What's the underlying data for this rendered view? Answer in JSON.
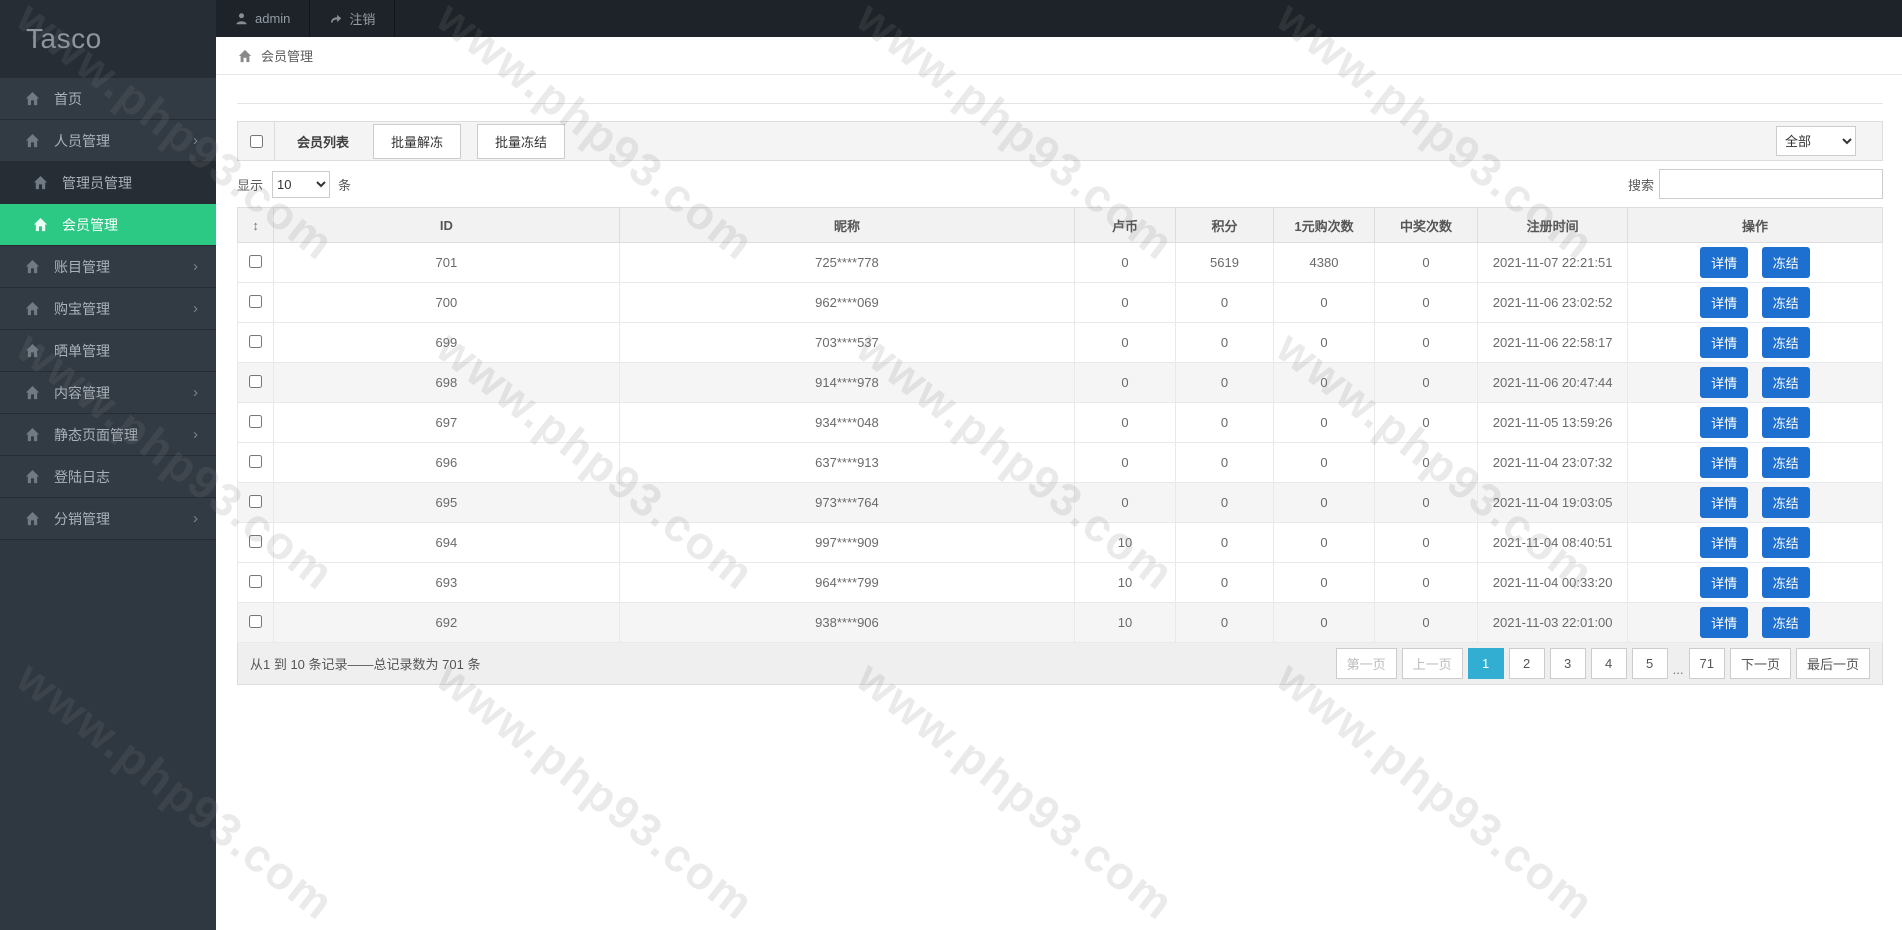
{
  "colors": {
    "accent_green": "#2cc985",
    "button_blue": "#1e70d0",
    "page_active": "#31aed1"
  },
  "watermark": {
    "text": "www.php93.com"
  },
  "topbar": {
    "user": "admin",
    "logout": "注销"
  },
  "sidebar": {
    "logo": "Tasco",
    "items": [
      {
        "label": "首页",
        "type": "item"
      },
      {
        "label": "人员管理",
        "type": "parent"
      },
      {
        "label": "管理员管理",
        "type": "sub"
      },
      {
        "label": "会员管理",
        "type": "sub",
        "active": true
      },
      {
        "label": "账目管理",
        "type": "parent"
      },
      {
        "label": "购宝管理",
        "type": "parent"
      },
      {
        "label": "晒单管理",
        "type": "item"
      },
      {
        "label": "内容管理",
        "type": "parent"
      },
      {
        "label": "静态页面管理",
        "type": "parent"
      },
      {
        "label": "登陆日志",
        "type": "item"
      },
      {
        "label": "分销管理",
        "type": "parent"
      }
    ]
  },
  "breadcrumb": {
    "label": "会员管理"
  },
  "toolbar": {
    "list_label": "会员列表",
    "batch_unfreeze": "批量解冻",
    "batch_freeze": "批量冻结",
    "filter_selected": "全部",
    "show_label": "显示",
    "page_size": "10",
    "unit_label": "条",
    "search_label": "搜索",
    "search_value": ""
  },
  "table": {
    "sort_icon": "↕",
    "columns": [
      "ID",
      "昵称",
      "卢币",
      "积分",
      "1元购次数",
      "中奖次数",
      "注册时间",
      "操作"
    ],
    "detail_btn": "详情",
    "freeze_btn": "冻结",
    "rows": [
      {
        "id": "701",
        "nick": "725****778",
        "coin": "0",
        "points": "5619",
        "buy": "4380",
        "win": "0",
        "time": "2021-11-07 22:21:51"
      },
      {
        "id": "700",
        "nick": "962****069",
        "coin": "0",
        "points": "0",
        "buy": "0",
        "win": "0",
        "time": "2021-11-06 23:02:52"
      },
      {
        "id": "699",
        "nick": "703****537",
        "coin": "0",
        "points": "0",
        "buy": "0",
        "win": "0",
        "time": "2021-11-06 22:58:17"
      },
      {
        "id": "698",
        "nick": "914****978",
        "coin": "0",
        "points": "0",
        "buy": "0",
        "win": "0",
        "time": "2021-11-06 20:47:44",
        "shaded": true
      },
      {
        "id": "697",
        "nick": "934****048",
        "coin": "0",
        "points": "0",
        "buy": "0",
        "win": "0",
        "time": "2021-11-05 13:59:26"
      },
      {
        "id": "696",
        "nick": "637****913",
        "coin": "0",
        "points": "0",
        "buy": "0",
        "win": "0",
        "time": "2021-11-04 23:07:32"
      },
      {
        "id": "695",
        "nick": "973****764",
        "coin": "0",
        "points": "0",
        "buy": "0",
        "win": "0",
        "time": "2021-11-04 19:03:05",
        "shaded": true
      },
      {
        "id": "694",
        "nick": "997****909",
        "coin": "10",
        "points": "0",
        "buy": "0",
        "win": "0",
        "time": "2021-11-04 08:40:51"
      },
      {
        "id": "693",
        "nick": "964****799",
        "coin": "10",
        "points": "0",
        "buy": "0",
        "win": "0",
        "time": "2021-11-04 00:33:20"
      },
      {
        "id": "692",
        "nick": "938****906",
        "coin": "10",
        "points": "0",
        "buy": "0",
        "win": "0",
        "time": "2021-11-03 22:01:00",
        "shaded": true
      }
    ]
  },
  "footer": {
    "summary": "从1 到 10 条记录——总记录数为 701 条",
    "pagination": [
      {
        "label": "第一页",
        "state": "disabled"
      },
      {
        "label": "上一页",
        "state": "disabled"
      },
      {
        "label": "1",
        "state": "active"
      },
      {
        "label": "2"
      },
      {
        "label": "3"
      },
      {
        "label": "4"
      },
      {
        "label": "5"
      },
      {
        "label": "...",
        "state": "ellipsis"
      },
      {
        "label": "71"
      },
      {
        "label": "下一页"
      },
      {
        "label": "最后一页"
      }
    ]
  }
}
